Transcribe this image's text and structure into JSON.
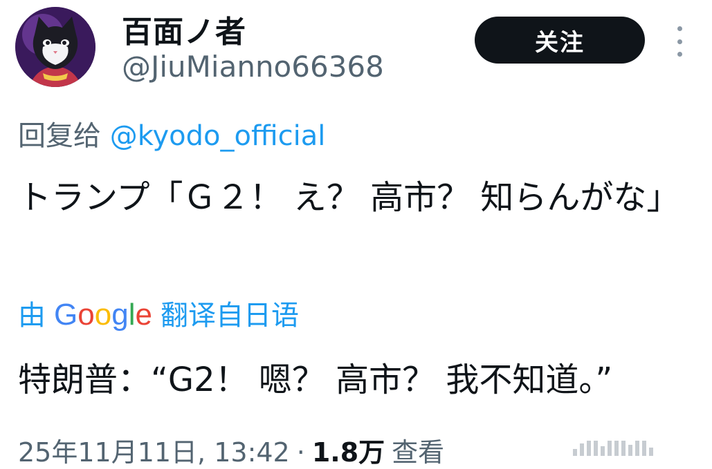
{
  "user": {
    "display_name": "百面ノ者",
    "handle": "@JiuMianno66368",
    "avatar_icon": "cat-avatar-icon"
  },
  "actions": {
    "follow_label": "关注",
    "more_icon": "more-vertical-icon"
  },
  "reply": {
    "prefix": "回复给",
    "mention": "@kyodo_official"
  },
  "tweet": {
    "text": "トランプ「Ｇ２！ え？ 高市？ 知らんがな」"
  },
  "translation": {
    "prefix": "由",
    "provider_letters": [
      "G",
      "o",
      "o",
      "g",
      "l",
      "e"
    ],
    "suffix": "翻译自日语",
    "text": "特朗普：“G2！ 嗯？ 高市？ 我不知道。”"
  },
  "meta": {
    "timestamp": "25年11月11日, 13:42",
    "separator": "·",
    "views_count": "1.8万",
    "views_label": "查看"
  },
  "colors": {
    "link": "#1d9bf0",
    "secondary_text": "#536471",
    "primary_text": "#0f1419",
    "button_bg": "#0f1419"
  }
}
